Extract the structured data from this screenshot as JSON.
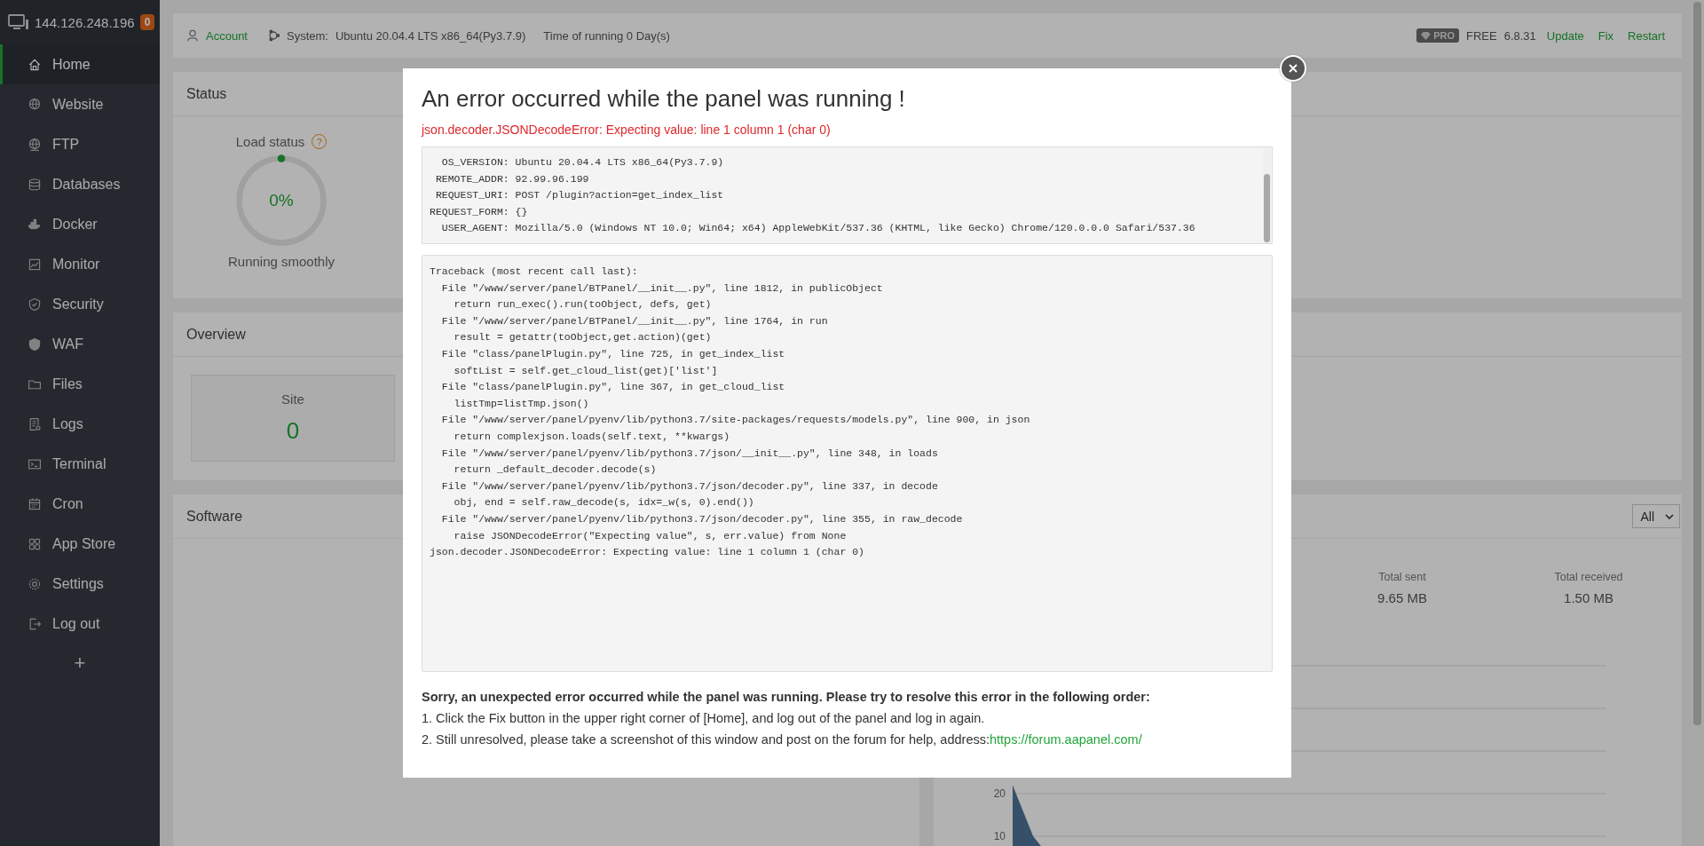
{
  "server": {
    "address": "144.126.248.196",
    "badge": "0"
  },
  "sidebar": {
    "items": [
      {
        "label": "Home",
        "selected": true
      },
      {
        "label": "Website",
        "selected": false
      },
      {
        "label": "FTP",
        "selected": false
      },
      {
        "label": "Databases",
        "selected": false
      },
      {
        "label": "Docker",
        "selected": false
      },
      {
        "label": "Monitor",
        "selected": false
      },
      {
        "label": "Security",
        "selected": false
      },
      {
        "label": "WAF",
        "selected": false
      },
      {
        "label": "Files",
        "selected": false
      },
      {
        "label": "Logs",
        "selected": false
      },
      {
        "label": "Terminal",
        "selected": false
      },
      {
        "label": "Cron",
        "selected": false
      },
      {
        "label": "App Store",
        "selected": false
      },
      {
        "label": "Settings",
        "selected": false
      },
      {
        "label": "Log out",
        "selected": false
      }
    ],
    "add_label": "+"
  },
  "topbar": {
    "account": "Account",
    "system_label": "System:",
    "system": "Ubuntu 20.04.4 LTS x86_64(Py3.7.9)",
    "uptime": "Time of running 0 Day(s)",
    "edition_badge": "PRO",
    "edition": "FREE",
    "version": "6.8.31",
    "links": [
      "Update",
      "Fix",
      "Restart"
    ]
  },
  "status": {
    "title": "Status",
    "load": {
      "label": "Load status",
      "help": "?",
      "reading": "0%",
      "caption": "Running smoothly"
    }
  },
  "overview": {
    "title": "Overview",
    "cards": [
      {
        "label": "Site",
        "value": "0"
      }
    ]
  },
  "software": {
    "title": "Software"
  },
  "network": {
    "filter": "All",
    "stats": [
      {
        "label": "Total sent",
        "value": "9.65 MB"
      },
      {
        "label": "Total received",
        "value": "1.50 MB"
      }
    ],
    "chart_data": {
      "type": "area",
      "ylim": [
        0,
        50
      ],
      "yticks": [
        10,
        20
      ],
      "series": [
        {
          "color": "#4f7399",
          "values": [
            22,
            10,
            4,
            1,
            0,
            0,
            0,
            0,
            0,
            0,
            0,
            0,
            0,
            0,
            0,
            0,
            0,
            0,
            0,
            0,
            0,
            0,
            0,
            0,
            0,
            0,
            0,
            0,
            0,
            0
          ]
        }
      ]
    }
  },
  "dialog": {
    "title": "An error occurred while the panel was running !",
    "error": "json.decoder.JSONDecodeError: Expecting value: line 1 column 1 (char 0)",
    "request_lines": [
      "  OS_VERSION: Ubuntu 20.04.4 LTS x86_64(Py3.7.9)",
      " REMOTE_ADDR: 92.99.96.199",
      " REQUEST_URI: POST /plugin?action=get_index_list",
      "REQUEST_FORM: {}",
      "  USER_AGENT: Mozilla/5.0 (Windows NT 10.0; Win64; x64) AppleWebKit/537.36 (KHTML, like Gecko) Chrome/120.0.0.0 Safari/537.36"
    ],
    "traceback_lines": [
      "Traceback (most recent call last):",
      "  File \"/www/server/panel/BTPanel/__init__.py\", line 1812, in publicObject",
      "    return run_exec().run(toObject, defs, get)",
      "  File \"/www/server/panel/BTPanel/__init__.py\", line 1764, in run",
      "    result = getattr(toObject,get.action)(get)",
      "  File \"class/panelPlugin.py\", line 725, in get_index_list",
      "    softList = self.get_cloud_list(get)['list']",
      "  File \"class/panelPlugin.py\", line 367, in get_cloud_list",
      "    listTmp=listTmp.json()",
      "  File \"/www/server/panel/pyenv/lib/python3.7/site-packages/requests/models.py\", line 900, in json",
      "    return complexjson.loads(self.text, **kwargs)",
      "  File \"/www/server/panel/pyenv/lib/python3.7/json/__init__.py\", line 348, in loads",
      "    return _default_decoder.decode(s)",
      "  File \"/www/server/panel/pyenv/lib/python3.7/json/decoder.py\", line 337, in decode",
      "    obj, end = self.raw_decode(s, idx=_w(s, 0).end())",
      "  File \"/www/server/panel/pyenv/lib/python3.7/json/decoder.py\", line 355, in raw_decode",
      "    raise JSONDecodeError(\"Expecting value\", s, err.value) from None",
      "json.decoder.JSONDecodeError: Expecting value: line 1 column 1 (char 0)"
    ],
    "help": {
      "heading": "Sorry, an unexpected error occurred while the panel was running. Please try to resolve this error in the following order:",
      "steps": [
        "1. Click the Fix button in the upper right corner of [Home], and log out of the panel and log in again.",
        "2. Still unresolved, please take a screenshot of this window and post on the forum for help, address:"
      ],
      "link": "https://forum.aapanel.com/"
    }
  }
}
